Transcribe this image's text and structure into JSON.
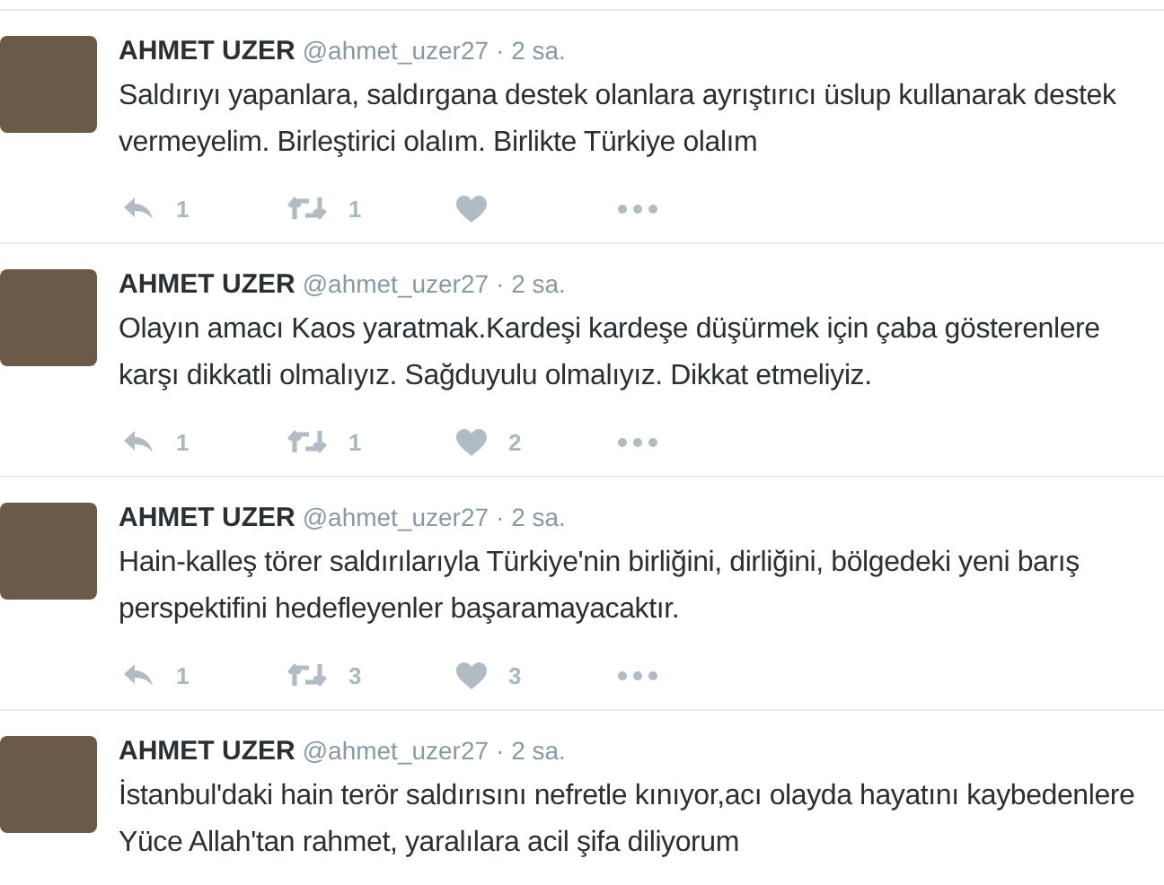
{
  "tweets": [
    {
      "name": "AHMET UZER",
      "handle": "@ahmet_uzer27",
      "time": "· 2 sa.",
      "text": "Saldırıyı yapanlara, saldırgana destek olanlara ayrıştırıcı üslup kullanarak destek vermeyelim. Birleştirici olalım. Birlikte Türkiye olalım",
      "actions": {
        "replies": "1",
        "retweets": "1"
      }
    },
    {
      "name": "AHMET UZER",
      "handle": "@ahmet_uzer27",
      "time": "· 2 sa.",
      "text": "Olayın amacı Kaos yaratmak.Kardeşi kardeşe düşürmek için çaba gösterenlere karşı dikkatli olmalıyız. Sağduyulu olmalıyız. Dikkat etmeliyiz.",
      "actions": {
        "replies": "1",
        "retweets": "1",
        "likes": "2"
      }
    },
    {
      "name": "AHMET UZER",
      "handle": "@ahmet_uzer27",
      "time": "· 2 sa.",
      "text": "Hain-kalleş törer saldırılarıyla Türkiye'nin birliğini, dirliğini, bölgedeki yeni barış perspektifini hedefleyenler başaramayacaktır.",
      "actions": {
        "replies": "1",
        "retweets": "3",
        "likes": "3"
      }
    },
    {
      "name": "AHMET UZER",
      "handle": "@ahmet_uzer27",
      "time": "· 2 sa.",
      "text": "İstanbul'daki hain terör saldırısını nefretle kınıyor,acı olayda hayatını kaybedenlere Yüce Allah'tan rahmet, yaralılara acil şifa diliyorum"
    }
  ]
}
